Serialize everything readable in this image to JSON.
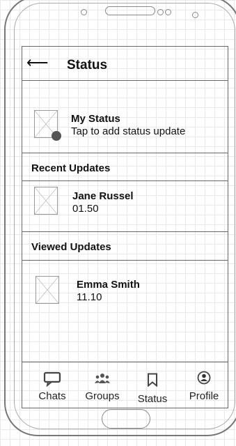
{
  "header": {
    "title": "Status",
    "back_icon": "arrow-left-icon"
  },
  "my_status": {
    "title": "My Status",
    "subtitle": "Tap to add status update"
  },
  "recent": {
    "label": "Recent Updates",
    "items": [
      {
        "name": "Jane Russel",
        "time": "01.50"
      }
    ]
  },
  "viewed": {
    "label": "Viewed Updates",
    "items": [
      {
        "name": "Emma Smith",
        "time": "11.10"
      }
    ]
  },
  "tabs": [
    {
      "label": "Chats",
      "icon": "chat-icon"
    },
    {
      "label": "Groups",
      "icon": "groups-icon"
    },
    {
      "label": "Status",
      "icon": "bookmark-icon"
    },
    {
      "label": "Profile",
      "icon": "profile-icon"
    }
  ]
}
